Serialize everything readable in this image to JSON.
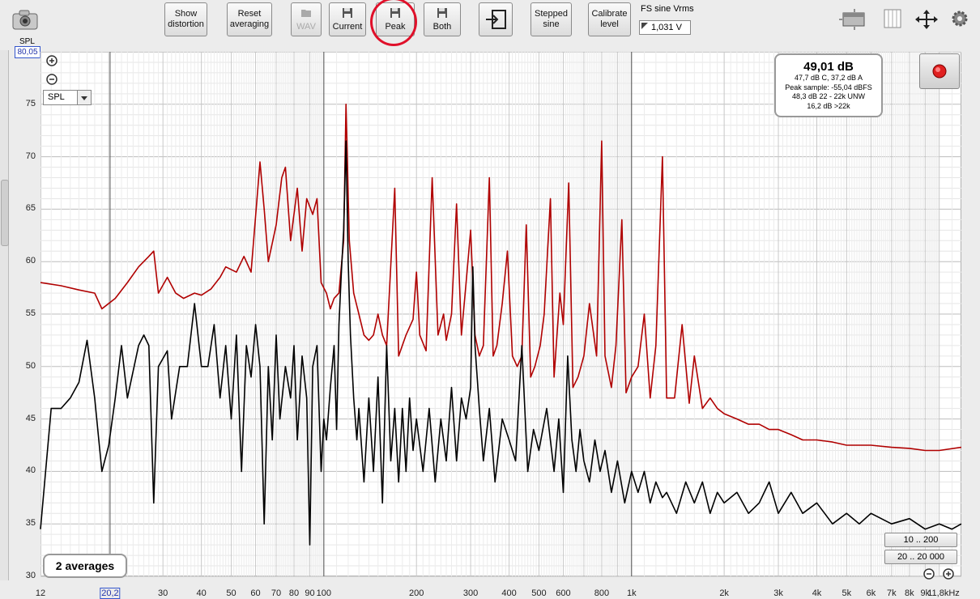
{
  "toolbar": {
    "show_distortion": "Show\ndistortion",
    "reset_averaging": "Reset\naveraging",
    "wav": "WAV",
    "current": "Current",
    "peak": "Peak",
    "both": "Both",
    "stepped_sine": "Stepped\nsine",
    "calibrate_level": "Calibrate\nlevel",
    "fs_label": "FS sine Vrms",
    "fs_value": "1,031 V"
  },
  "left_panel": {
    "spl_label": "SPL",
    "spl_value": "80,05",
    "unit_select": "SPL"
  },
  "readout": {
    "main": "49,01 dB",
    "line1": "47,7 dB C, 37,2 dB A",
    "line2": "Peak sample: -55,04 dBFS",
    "line3": "48,3 dB 22 - 22k UNW",
    "line4": "16,2 dB >22k"
  },
  "averages_label": "2 averages",
  "range_buttons": [
    "10 .. 200",
    "20 .. 20 000"
  ],
  "colors": {
    "peak_trace": "#b00000",
    "current_trace": "#000000",
    "highlight_circle": "#e0102a"
  },
  "chart_data": {
    "type": "line",
    "x_scale": "log",
    "xlim": [
      12,
      11800
    ],
    "ylim": [
      30,
      80
    ],
    "y_ticks": [
      30,
      35,
      40,
      45,
      50,
      55,
      60,
      65,
      70,
      75
    ],
    "y_tick_labels": [
      "30",
      "35",
      "40",
      "45",
      "50",
      "55",
      "60",
      "65",
      "70",
      "75"
    ],
    "x_ticks": [
      {
        "v": 12,
        "label": "12"
      },
      {
        "v": 20.2,
        "label": "20,2"
      },
      {
        "v": 30,
        "label": "30"
      },
      {
        "v": 40,
        "label": "40"
      },
      {
        "v": 50,
        "label": "50"
      },
      {
        "v": 60,
        "label": "60"
      },
      {
        "v": 70,
        "label": "70"
      },
      {
        "v": 80,
        "label": "80"
      },
      {
        "v": 90,
        "label": "90"
      },
      {
        "v": 100,
        "label": "100"
      },
      {
        "v": 200,
        "label": "200"
      },
      {
        "v": 300,
        "label": "300"
      },
      {
        "v": 400,
        "label": "400"
      },
      {
        "v": 500,
        "label": "500"
      },
      {
        "v": 600,
        "label": "600"
      },
      {
        "v": 800,
        "label": "800"
      },
      {
        "v": 1000,
        "label": "1k"
      },
      {
        "v": 2000,
        "label": "2k"
      },
      {
        "v": 3000,
        "label": "3k"
      },
      {
        "v": 4000,
        "label": "4k"
      },
      {
        "v": 5000,
        "label": "5k"
      },
      {
        "v": 6000,
        "label": "6k"
      },
      {
        "v": 7000,
        "label": "7k"
      },
      {
        "v": 8000,
        "label": "8k"
      },
      {
        "v": 9000,
        "label": "9k"
      },
      {
        "v": 11800,
        "label": "11,8kHz"
      }
    ],
    "series": [
      {
        "color": "#b00000",
        "points": [
          [
            12,
            58
          ],
          [
            14,
            57.7
          ],
          [
            16,
            57.3
          ],
          [
            18,
            57
          ],
          [
            19,
            55.5
          ],
          [
            21,
            56.5
          ],
          [
            23,
            58
          ],
          [
            25,
            59.5
          ],
          [
            27,
            60.5
          ],
          [
            28,
            61
          ],
          [
            29,
            57
          ],
          [
            31,
            58.5
          ],
          [
            33,
            57
          ],
          [
            35,
            56.5
          ],
          [
            38,
            57
          ],
          [
            40,
            56.8
          ],
          [
            43,
            57.4
          ],
          [
            46,
            58.5
          ],
          [
            48,
            59.5
          ],
          [
            52,
            59
          ],
          [
            55,
            60.5
          ],
          [
            58,
            59
          ],
          [
            62,
            69.5
          ],
          [
            64,
            65
          ],
          [
            66,
            60
          ],
          [
            70,
            63.5
          ],
          [
            73,
            68
          ],
          [
            75,
            69
          ],
          [
            78,
            62
          ],
          [
            82,
            67
          ],
          [
            85,
            61
          ],
          [
            88,
            66
          ],
          [
            92,
            64.5
          ],
          [
            95,
            66
          ],
          [
            98,
            58
          ],
          [
            102,
            57
          ],
          [
            105,
            55.5
          ],
          [
            108,
            56.5
          ],
          [
            112,
            57
          ],
          [
            116,
            62
          ],
          [
            118,
            75
          ],
          [
            121,
            62
          ],
          [
            125,
            57
          ],
          [
            130,
            55
          ],
          [
            135,
            53
          ],
          [
            140,
            52.5
          ],
          [
            145,
            53
          ],
          [
            150,
            55
          ],
          [
            155,
            53
          ],
          [
            160,
            52
          ],
          [
            170,
            67
          ],
          [
            175,
            51
          ],
          [
            185,
            53
          ],
          [
            195,
            54.5
          ],
          [
            200,
            59
          ],
          [
            205,
            53
          ],
          [
            215,
            51.5
          ],
          [
            225,
            68
          ],
          [
            235,
            53
          ],
          [
            245,
            55
          ],
          [
            250,
            52.5
          ],
          [
            260,
            55
          ],
          [
            270,
            65.5
          ],
          [
            280,
            53
          ],
          [
            290,
            58
          ],
          [
            300,
            63
          ],
          [
            310,
            53
          ],
          [
            320,
            51
          ],
          [
            330,
            52
          ],
          [
            345,
            68
          ],
          [
            355,
            51
          ],
          [
            365,
            52
          ],
          [
            380,
            56
          ],
          [
            395,
            61
          ],
          [
            410,
            51
          ],
          [
            425,
            50
          ],
          [
            440,
            51
          ],
          [
            455,
            63.5
          ],
          [
            470,
            49
          ],
          [
            485,
            50
          ],
          [
            505,
            52
          ],
          [
            520,
            55
          ],
          [
            545,
            66
          ],
          [
            560,
            49
          ],
          [
            585,
            57
          ],
          [
            600,
            54
          ],
          [
            625,
            67.5
          ],
          [
            645,
            48
          ],
          [
            670,
            49
          ],
          [
            700,
            51
          ],
          [
            730,
            56
          ],
          [
            770,
            51
          ],
          [
            800,
            71.5
          ],
          [
            820,
            51
          ],
          [
            860,
            48
          ],
          [
            890,
            52
          ],
          [
            930,
            64
          ],
          [
            960,
            47.5
          ],
          [
            1000,
            49
          ],
          [
            1050,
            50
          ],
          [
            1100,
            55
          ],
          [
            1150,
            47
          ],
          [
            1200,
            52
          ],
          [
            1260,
            70
          ],
          [
            1300,
            47
          ],
          [
            1380,
            47
          ],
          [
            1460,
            54
          ],
          [
            1540,
            46.5
          ],
          [
            1600,
            51
          ],
          [
            1700,
            46
          ],
          [
            1800,
            47
          ],
          [
            1900,
            46
          ],
          [
            2000,
            45.5
          ],
          [
            2200,
            45
          ],
          [
            2400,
            44.5
          ],
          [
            2600,
            44.5
          ],
          [
            2800,
            44
          ],
          [
            3000,
            44
          ],
          [
            3300,
            43.5
          ],
          [
            3600,
            43
          ],
          [
            4000,
            43
          ],
          [
            4500,
            42.8
          ],
          [
            5000,
            42.5
          ],
          [
            6000,
            42.5
          ],
          [
            7000,
            42.3
          ],
          [
            8000,
            42.2
          ],
          [
            9000,
            42
          ],
          [
            10000,
            42
          ],
          [
            11800,
            42.3
          ]
        ]
      },
      {
        "color": "#000000",
        "points": [
          [
            12,
            34.5
          ],
          [
            13,
            46
          ],
          [
            14,
            46
          ],
          [
            15,
            47
          ],
          [
            16,
            48.5
          ],
          [
            17,
            52.5
          ],
          [
            18,
            47
          ],
          [
            19,
            40
          ],
          [
            20,
            42.5
          ],
          [
            21,
            47
          ],
          [
            22,
            52
          ],
          [
            23,
            47
          ],
          [
            25,
            52
          ],
          [
            26,
            53
          ],
          [
            27,
            52
          ],
          [
            28,
            37
          ],
          [
            29,
            50
          ],
          [
            31,
            51.5
          ],
          [
            32,
            45
          ],
          [
            34,
            50
          ],
          [
            36,
            50
          ],
          [
            38,
            56
          ],
          [
            40,
            50
          ],
          [
            42,
            50
          ],
          [
            44,
            54
          ],
          [
            46,
            47
          ],
          [
            48,
            52
          ],
          [
            50,
            45
          ],
          [
            52,
            53
          ],
          [
            54,
            40
          ],
          [
            56,
            52
          ],
          [
            58,
            49
          ],
          [
            60,
            54
          ],
          [
            62,
            50
          ],
          [
            64,
            35
          ],
          [
            66,
            50
          ],
          [
            68,
            43
          ],
          [
            70,
            53
          ],
          [
            72,
            45
          ],
          [
            75,
            50
          ],
          [
            78,
            47
          ],
          [
            80,
            52
          ],
          [
            82,
            43
          ],
          [
            85,
            51
          ],
          [
            88,
            47
          ],
          [
            90,
            33
          ],
          [
            92,
            50
          ],
          [
            95,
            52
          ],
          [
            98,
            40
          ],
          [
            100,
            45
          ],
          [
            102,
            43
          ],
          [
            105,
            48
          ],
          [
            108,
            52
          ],
          [
            110,
            44
          ],
          [
            112,
            54
          ],
          [
            114,
            59
          ],
          [
            116,
            63
          ],
          [
            118,
            71.5
          ],
          [
            120,
            60
          ],
          [
            122,
            53
          ],
          [
            125,
            47
          ],
          [
            128,
            43
          ],
          [
            130,
            46
          ],
          [
            135,
            39
          ],
          [
            140,
            47
          ],
          [
            145,
            40
          ],
          [
            150,
            49
          ],
          [
            155,
            37
          ],
          [
            160,
            52
          ],
          [
            165,
            41
          ],
          [
            170,
            46
          ],
          [
            175,
            39
          ],
          [
            180,
            46
          ],
          [
            185,
            40
          ],
          [
            190,
            47
          ],
          [
            195,
            42
          ],
          [
            200,
            45
          ],
          [
            210,
            40
          ],
          [
            220,
            46
          ],
          [
            230,
            39
          ],
          [
            240,
            45
          ],
          [
            250,
            41
          ],
          [
            260,
            48
          ],
          [
            270,
            41
          ],
          [
            280,
            47
          ],
          [
            290,
            45
          ],
          [
            300,
            48
          ],
          [
            305,
            59.5
          ],
          [
            310,
            52
          ],
          [
            320,
            46
          ],
          [
            330,
            41
          ],
          [
            345,
            46
          ],
          [
            360,
            39
          ],
          [
            380,
            45
          ],
          [
            400,
            43
          ],
          [
            420,
            41
          ],
          [
            440,
            52
          ],
          [
            460,
            40
          ],
          [
            480,
            44
          ],
          [
            500,
            42
          ],
          [
            530,
            46
          ],
          [
            560,
            40
          ],
          [
            580,
            45
          ],
          [
            600,
            38
          ],
          [
            620,
            51
          ],
          [
            640,
            43
          ],
          [
            660,
            40
          ],
          [
            680,
            44
          ],
          [
            700,
            41
          ],
          [
            730,
            39
          ],
          [
            760,
            43
          ],
          [
            790,
            40
          ],
          [
            820,
            42
          ],
          [
            860,
            38
          ],
          [
            900,
            41
          ],
          [
            950,
            37
          ],
          [
            1000,
            40
          ],
          [
            1050,
            38
          ],
          [
            1100,
            40
          ],
          [
            1150,
            37
          ],
          [
            1200,
            39
          ],
          [
            1260,
            37.5
          ],
          [
            1300,
            38
          ],
          [
            1400,
            36
          ],
          [
            1500,
            39
          ],
          [
            1600,
            37
          ],
          [
            1700,
            39
          ],
          [
            1800,
            36
          ],
          [
            1900,
            38
          ],
          [
            2000,
            37
          ],
          [
            2200,
            38
          ],
          [
            2400,
            36
          ],
          [
            2600,
            37
          ],
          [
            2800,
            39
          ],
          [
            3000,
            36
          ],
          [
            3300,
            38
          ],
          [
            3600,
            36
          ],
          [
            4000,
            37
          ],
          [
            4500,
            35
          ],
          [
            5000,
            36
          ],
          [
            5500,
            35
          ],
          [
            6000,
            36
          ],
          [
            7000,
            35
          ],
          [
            8000,
            35.5
          ],
          [
            9000,
            34.5
          ],
          [
            10000,
            35
          ],
          [
            11000,
            34.5
          ],
          [
            11800,
            35
          ]
        ]
      }
    ]
  }
}
